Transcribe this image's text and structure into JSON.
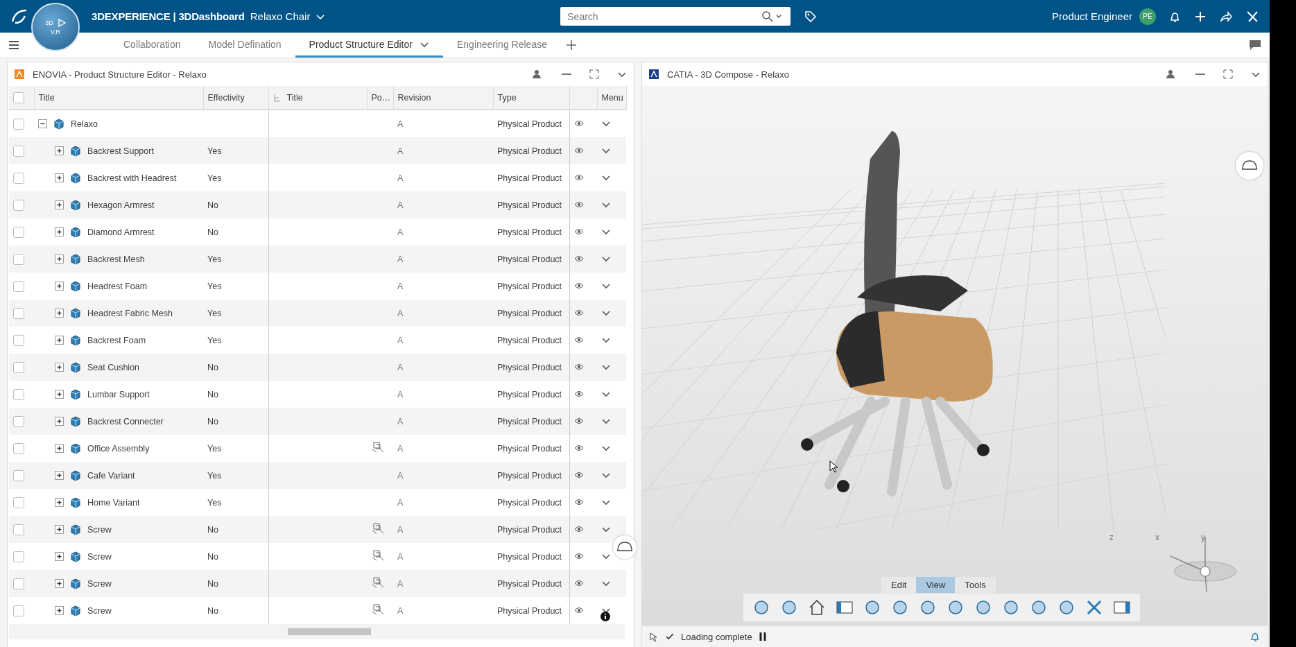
{
  "topbar": {
    "brand": "3DEXPERIENCE | 3DDashboard",
    "dashboard": "Relaxo Chair",
    "search": {
      "placeholder": "Search"
    },
    "user": "Product Engineer",
    "avatar": "PE"
  },
  "compass": {
    "top": "3D",
    "bottom": "V,R"
  },
  "tabs": [
    {
      "label": "Collaboration",
      "selected": false
    },
    {
      "label": "Model Defination",
      "selected": false
    },
    {
      "label": "Product Structure Editor",
      "selected": true
    },
    {
      "label": "Engineering Release",
      "selected": false
    }
  ],
  "left_panel": {
    "title": "ENOVIA - Product Structure Editor - Relaxo",
    "table": {
      "columns": [
        "Title",
        "Effectivity",
        "Title",
        "Po…",
        "Revision",
        "Type",
        "Menu"
      ],
      "select_all_checked": false,
      "root": {
        "title": "Relaxo",
        "revision": "A",
        "type": "Physical Product",
        "expanded": true,
        "positioned": false,
        "checked": false,
        "children": [
          {
            "title": "Backrest Support",
            "effectivity": "Yes",
            "revision": "A",
            "type": "Physical Product",
            "expanded": false,
            "positioned": false,
            "checked": false
          },
          {
            "title": "Backrest with Headrest",
            "effectivity": "Yes",
            "revision": "A",
            "type": "Physical Product",
            "expanded": false,
            "positioned": false,
            "checked": false
          },
          {
            "title": "Hexagon Armrest",
            "effectivity": "No",
            "revision": "A",
            "type": "Physical Product",
            "expanded": false,
            "positioned": false,
            "checked": false
          },
          {
            "title": "Diamond Armrest",
            "effectivity": "No",
            "revision": "A",
            "type": "Physical Product",
            "expanded": false,
            "positioned": false,
            "checked": false
          },
          {
            "title": "Backrest Mesh",
            "effectivity": "Yes",
            "revision": "A",
            "type": "Physical Product",
            "expanded": false,
            "positioned": false,
            "checked": false
          },
          {
            "title": "Headrest Foam",
            "effectivity": "Yes",
            "revision": "A",
            "type": "Physical Product",
            "expanded": false,
            "positioned": false,
            "checked": false
          },
          {
            "title": "Headrest Fabric Mesh",
            "effectivity": "Yes",
            "revision": "A",
            "type": "Physical Product",
            "expanded": false,
            "positioned": false,
            "checked": false
          },
          {
            "title": "Backrest Foam",
            "effectivity": "Yes",
            "revision": "A",
            "type": "Physical Product",
            "expanded": false,
            "positioned": false,
            "checked": false
          },
          {
            "title": "Seat Cushion",
            "effectivity": "No",
            "revision": "A",
            "type": "Physical Product",
            "expanded": false,
            "positioned": false,
            "checked": false
          },
          {
            "title": "Lumbar Support",
            "effectivity": "No",
            "revision": "A",
            "type": "Physical Product",
            "expanded": false,
            "positioned": false,
            "checked": false
          },
          {
            "title": "Backrest Connecter",
            "effectivity": "No",
            "revision": "A",
            "type": "Physical Product",
            "expanded": false,
            "positioned": false,
            "checked": false
          },
          {
            "title": "Office Assembly",
            "effectivity": "Yes",
            "revision": "A",
            "type": "Physical Product",
            "expanded": false,
            "positioned": true,
            "checked": false
          },
          {
            "title": "Cafe Variant",
            "effectivity": "Yes",
            "revision": "A",
            "type": "Physical Product",
            "expanded": false,
            "positioned": false,
            "checked": false
          },
          {
            "title": "Home Variant",
            "effectivity": "Yes",
            "revision": "A",
            "type": "Physical Product",
            "expanded": false,
            "positioned": false,
            "checked": false
          },
          {
            "title": "Screw",
            "effectivity": "No",
            "revision": "A",
            "type": "Physical Product",
            "expanded": false,
            "positioned": true,
            "checked": false
          },
          {
            "title": "Screw",
            "effectivity": "No",
            "revision": "A",
            "type": "Physical Product",
            "expanded": false,
            "positioned": true,
            "checked": false
          },
          {
            "title": "Screw",
            "effectivity": "No",
            "revision": "A",
            "type": "Physical Product",
            "expanded": false,
            "positioned": true,
            "checked": false
          },
          {
            "title": "Screw",
            "effectivity": "No",
            "revision": "A",
            "type": "Physical Product",
            "expanded": false,
            "positioned": true,
            "checked": false
          }
        ]
      }
    }
  },
  "right_panel": {
    "title": "CATIA - 3D Compose - Relaxo",
    "toolbar_tabs": [
      {
        "label": "Edit",
        "selected": false
      },
      {
        "label": "View",
        "selected": true
      },
      {
        "label": "Tools",
        "selected": false
      }
    ],
    "axes": [
      "z",
      "x",
      "y"
    ],
    "status": "Loading complete"
  }
}
